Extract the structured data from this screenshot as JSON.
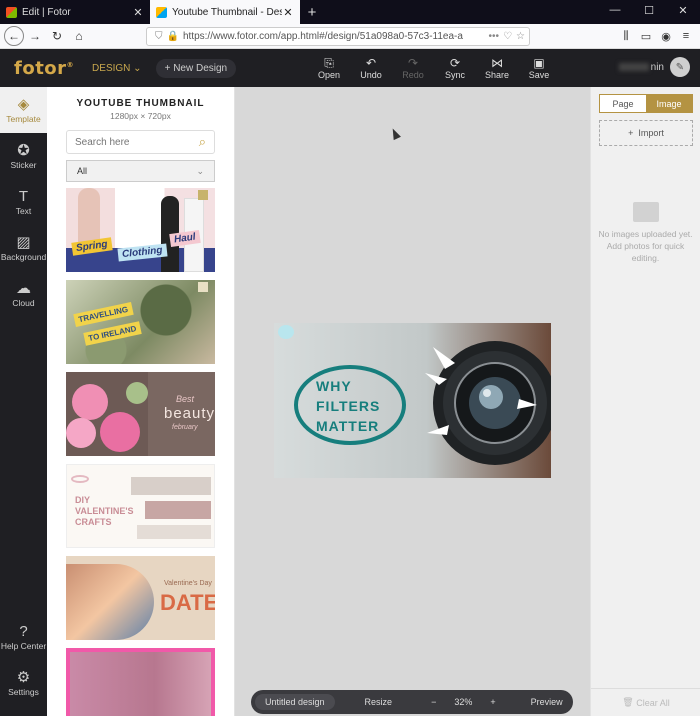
{
  "browser": {
    "tabs": [
      {
        "title": "Edit | Fotor",
        "active": false
      },
      {
        "title": "Youtube Thumbnail - Design | F",
        "active": true
      }
    ],
    "url": "https://www.fotor.com/app.html#/design/51a098a0-57c3-11ea-a"
  },
  "app": {
    "logo": "fotor",
    "design_menu": "DESIGN",
    "new_design": "New Design",
    "toolbar": [
      "Open",
      "Undo",
      "Redo",
      "Sync",
      "Share",
      "Save"
    ],
    "username_suffix": "nin"
  },
  "rail": {
    "items": [
      "Template",
      "Sticker",
      "Text",
      "Background",
      "Cloud"
    ],
    "bottom": [
      "Help Center",
      "Settings"
    ]
  },
  "panel": {
    "title": "YOUTUBE THUMBNAIL",
    "size": "1280px × 720px",
    "search_placeholder": "Search here",
    "filter": "All",
    "templates": [
      {
        "texts": [
          "Spring",
          "Clothing",
          "Haul"
        ]
      },
      {
        "texts": [
          "TRAVELLING",
          "TO IRELAND"
        ]
      },
      {
        "texts": [
          "Best",
          "beauty",
          "february"
        ]
      },
      {
        "texts": [
          "DIY",
          "VALENTINE'S",
          "CRAFTS"
        ]
      },
      {
        "texts": [
          "Valentine's Day",
          "DATE"
        ]
      },
      {
        "texts": []
      }
    ]
  },
  "canvas": {
    "design_text": [
      "WHY",
      "FILTERS",
      "MATTER"
    ],
    "doc_name": "Untitled design",
    "resize": "Resize",
    "zoom": "32%",
    "preview": "Preview"
  },
  "right": {
    "tabs": [
      "Page",
      "Image"
    ],
    "active_tab": "Image",
    "import": "Import",
    "empty_text": "No images uploaded yet. Add photos for quick editing.",
    "clear_all": "Clear All"
  }
}
